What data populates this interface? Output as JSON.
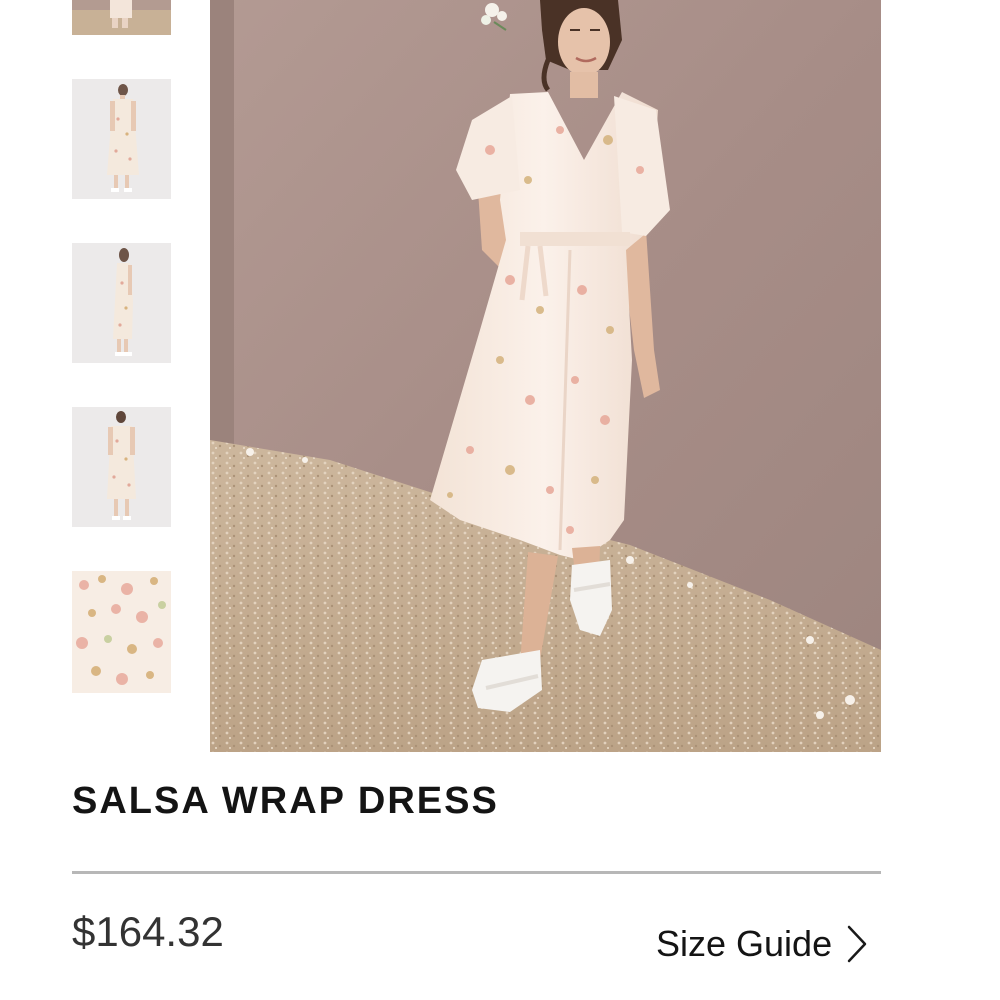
{
  "product": {
    "title": "SALSA WRAP DRESS",
    "price": "$164.32"
  },
  "size_guide": {
    "label": "Size Guide",
    "icon": "chevron-right-icon"
  },
  "gallery": {
    "thumbnails": [
      {
        "view": "model-walking-partial"
      },
      {
        "view": "model-front"
      },
      {
        "view": "model-side"
      },
      {
        "view": "model-back"
      },
      {
        "view": "fabric-print-closeup"
      }
    ],
    "selected": 0
  },
  "colors": {
    "wall": "#a88f89",
    "ground": "#c6ae93",
    "dress": "#f6e7dc",
    "print_pink": "#e7a798",
    "print_gold": "#d4b27c",
    "divider": "#b7b7b7",
    "text": "#141414"
  }
}
